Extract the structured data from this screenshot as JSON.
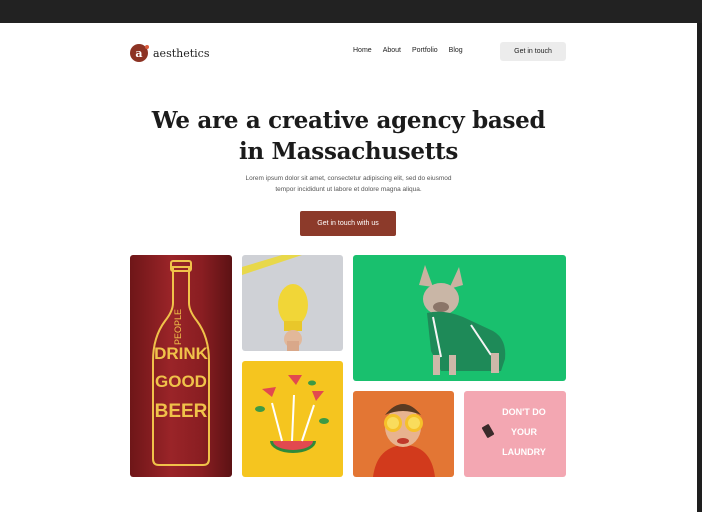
{
  "brand": {
    "mark": "a",
    "name": "aesthetics"
  },
  "nav": {
    "items": [
      "Home",
      "About",
      "Portfolio",
      "Blog"
    ],
    "cta": "Get in touch"
  },
  "hero": {
    "title_line1": "We are a creative agency based",
    "title_line2": "in Massachusetts",
    "subtitle_line1": "Lorem ipsum dolor sit amet, consectetur adipiscing elit, sed do eiusmod",
    "subtitle_line2": "tempor incididunt ut labore et dolore magna aliqua.",
    "cta": "Get in touch with us"
  },
  "gallery": {
    "beer": {
      "line1": "PEOPLE",
      "line2": "DRINK",
      "line3": "GOOD",
      "line4": "BEER"
    },
    "poster": {
      "line1": "DON'T DO",
      "line2": "YOUR",
      "line3": "LAUNDRY"
    }
  },
  "colors": {
    "accent": "#8c3a2a",
    "nav_button_bg": "#ececec",
    "beer_tile": "#8a1e22",
    "dog_tile": "#19c06e",
    "yellow_tile": "#f5c51f",
    "orange_tile": "#e37634",
    "pink_tile": "#f3a7b2"
  }
}
